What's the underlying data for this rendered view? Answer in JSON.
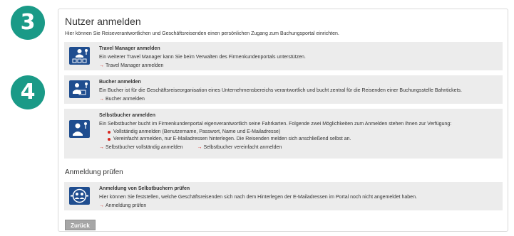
{
  "steps": {
    "step3": "3",
    "step4": "4"
  },
  "colors": {
    "badge": "#1a9a87",
    "icon_bg": "#1f4d8f",
    "arrow": "#d6271f",
    "card_bg": "#ececec",
    "button_bg": "#a6a6a6"
  },
  "page": {
    "title": "Nutzer anmelden",
    "intro": "Hier können Sie Reiseverantwortlichen und Geschäftsreisenden einen persönlichen Zugang zum Buchungsportal einrichten."
  },
  "cards": [
    {
      "icon": "travel-manager-icon",
      "title": "Travel Manager anmelden",
      "text": "Ein weiterer Travel Manager kann Sie beim Verwalten des Firmenkundenportals unterstützen.",
      "link": "Travel Manager anmelden"
    },
    {
      "icon": "booker-icon",
      "title": "Bucher anmelden",
      "text": "Ein Bucher ist für die Geschäftsreiseorganisation eines Unternehmensbereichs verantwortlich und bucht zentral für die Reisenden einer Buchungsstelle Bahntickets.",
      "link": "Bucher anmelden"
    },
    {
      "icon": "self-booker-icon",
      "title": "Selbstbucher anmelden",
      "text": "Ein Selbstbucher bucht im Firmenkundenportal eigenverantwortlich seine Fahrkarten. Folgende zwei Möglichkeiten zum Anmelden stehen Ihnen zur Verfügung:",
      "bullets": [
        "Vollständig anmelden (Benutzername, Passwort, Name und E-Mailadresse)",
        "Vereinfacht anmelden, nur E-Mailadressen hinterlegen. Die Reisenden melden sich anschließend selbst an."
      ],
      "links": [
        "Selbstbucher vollständig anmelden",
        "Selbstbucher vereinfacht anmelden"
      ]
    }
  ],
  "section2": {
    "title": "Anmeldung prüfen",
    "card": {
      "icon": "check-users-icon",
      "title": "Anmeldung von Selbstbuchern prüfen",
      "text": "Hier können Sie feststellen, welche Geschäftsreisenden sich nach dem Hinterlegen der E-Mailadressen im Portal noch nicht angemeldet haben.",
      "link": "Anmeldung prüfen"
    }
  },
  "arrow_glyph": "→",
  "back_button": "Zurück"
}
